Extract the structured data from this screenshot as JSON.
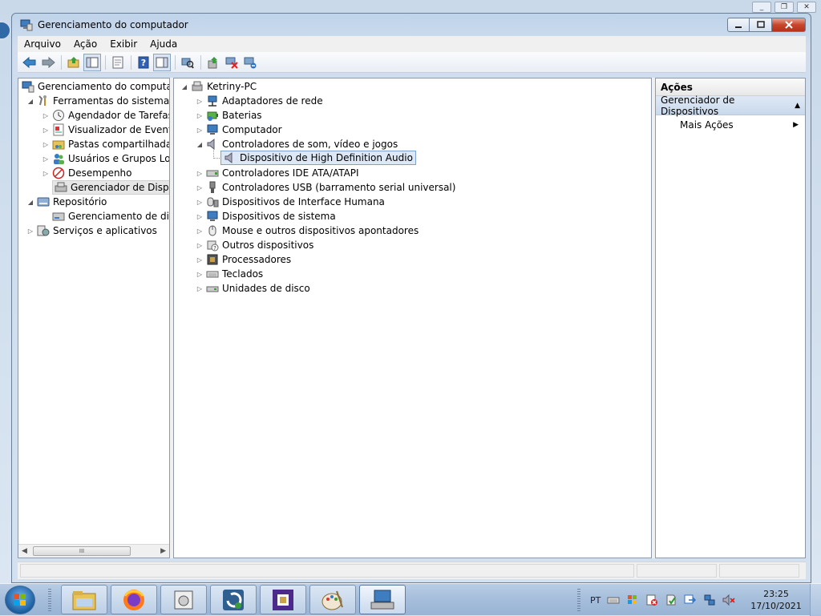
{
  "window": {
    "title": "Gerenciamento do computador",
    "min_icon": "minimize-icon",
    "max_icon": "maximize-icon",
    "close_icon": "close-icon"
  },
  "menu": [
    "Arquivo",
    "Ação",
    "Exibir",
    "Ajuda"
  ],
  "toolbar": {
    "icons": [
      "back-arrow-icon",
      "forward-arrow-icon",
      "up-folder-icon",
      "show-hide-tree-icon",
      "properties-icon",
      "help-icon",
      "show-hide-action-pane-icon",
      "scan-hardware-icon",
      "update-driver-icon",
      "disable-device-icon",
      "uninstall-device-icon"
    ]
  },
  "left_tree": {
    "root": "Gerenciamento do computador",
    "items": [
      {
        "label": "Ferramentas do sistema",
        "icon": "tools-icon"
      },
      {
        "label": "Agendador de Tarefas",
        "icon": "clock-icon"
      },
      {
        "label": "Visualizador de Eventos",
        "icon": "event-viewer-icon"
      },
      {
        "label": "Pastas compartilhadas",
        "icon": "shared-folder-icon"
      },
      {
        "label": "Usuários e Grupos Loca",
        "icon": "users-icon"
      },
      {
        "label": "Desempenho",
        "icon": "performance-icon"
      },
      {
        "label": "Gerenciador de Disposit",
        "icon": "device-manager-icon"
      },
      {
        "label": "Repositório",
        "icon": "storage-icon"
      },
      {
        "label": "Gerenciamento de disco",
        "icon": "disk-management-icon"
      },
      {
        "label": "Serviços e aplicativos",
        "icon": "services-icon"
      }
    ],
    "scroll_thumb": "III"
  },
  "device_tree": {
    "root": "Ketriny-PC",
    "categories": [
      {
        "label": "Adaptadores de rede",
        "icon": "network-adapter-icon"
      },
      {
        "label": "Baterias",
        "icon": "battery-icon"
      },
      {
        "label": "Computador",
        "icon": "computer-icon"
      },
      {
        "label": "Controladores de som, vídeo e jogos",
        "icon": "speaker-icon"
      },
      {
        "label": "Dispositivo de High Definition Audio",
        "icon": "speaker-icon"
      },
      {
        "label": "Controladores IDE ATA/ATAPI",
        "icon": "ide-controller-icon"
      },
      {
        "label": "Controladores USB (barramento serial universal)",
        "icon": "usb-icon"
      },
      {
        "label": "Dispositivos de Interface Humana",
        "icon": "hid-icon"
      },
      {
        "label": "Dispositivos de sistema",
        "icon": "system-device-icon"
      },
      {
        "label": "Mouse e outros dispositivos apontadores",
        "icon": "mouse-icon"
      },
      {
        "label": "Outros dispositivos",
        "icon": "unknown-device-icon"
      },
      {
        "label": "Processadores",
        "icon": "processor-icon"
      },
      {
        "label": "Teclados",
        "icon": "keyboard-icon"
      },
      {
        "label": "Unidades de disco",
        "icon": "disk-drive-icon"
      }
    ]
  },
  "actions": {
    "header": "Ações",
    "section": "Gerenciador de Dispositivos",
    "more": "Mais Ações"
  },
  "taskbar": {
    "apps": [
      "file-explorer-icon",
      "firefox-icon",
      "disk-cleanup-icon",
      "system-restore-icon",
      "cpu-z-icon",
      "paint-icon",
      "computer-management-icon"
    ],
    "lang": "PT",
    "time": "23:25",
    "date": "17/10/2021"
  },
  "colors": {
    "accent": "#3d6fb0",
    "selection": "#dce8f5",
    "close": "#c8452c"
  }
}
